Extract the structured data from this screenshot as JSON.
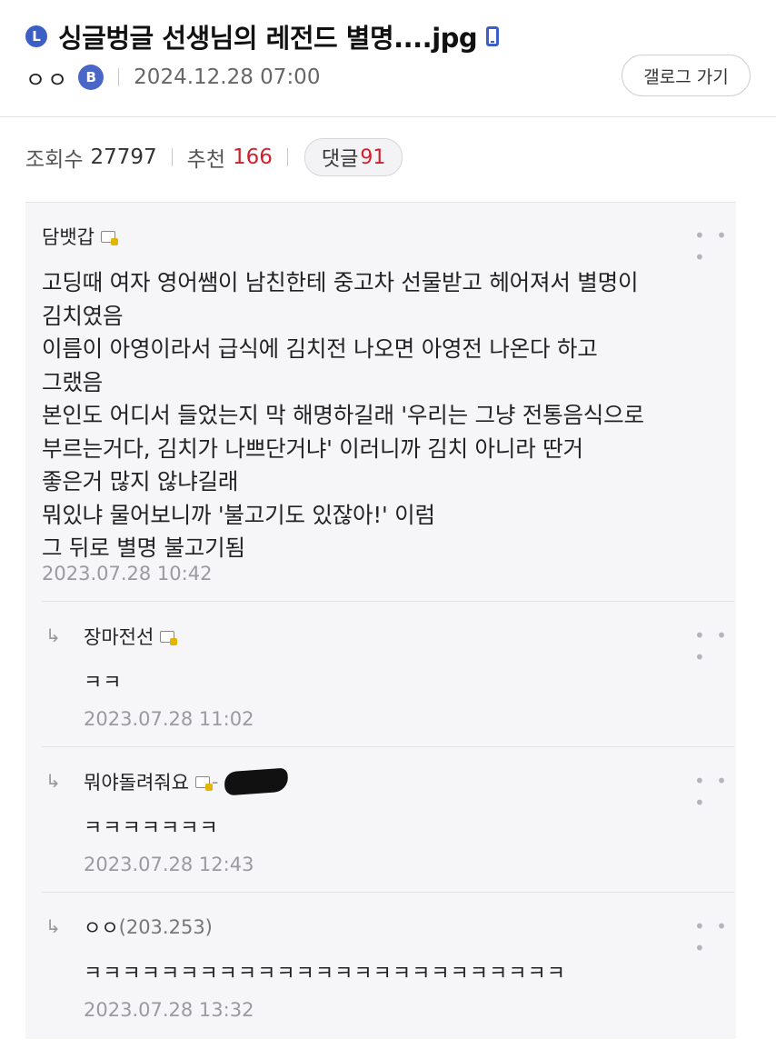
{
  "post": {
    "badge": "L",
    "title": "싱글벙글 선생님의 레전드 별명....jpg",
    "author": "ㅇㅇ",
    "author_badge": "B",
    "date": "2024.12.28 07:00",
    "gallery_button": "갤로그 가기"
  },
  "stats": {
    "views_label": "조회수",
    "views": "27797",
    "recommend_label": "추천",
    "recommend": "166",
    "comments_label": "댓글",
    "comments": "91"
  },
  "comments": [
    {
      "nick": "담뱃갑",
      "text": "고딩때 여자 영어쌤이 남친한테 중고차 선물받고 헤어져서 별명이\n김치였음\n이름이 아영이라서 급식에 김치전 나오면 아영전 나온다 하고\n그랬음\n본인도 어디서 들었는지 막 해명하길래 '우리는 그냥 전통음식으로\n부르는거다, 김치가 나쁘단거냐' 이러니까 김치 아니라 딴거\n좋은거 많지 않냐길래\n뭐있냐 물어보니까 '불고기도 있잖아!' 이럼\n그 뒤로 별명 불고기됨",
      "date": "2023.07.28 10:42"
    }
  ],
  "replies": [
    {
      "arrow": "↳",
      "nick": "장마전선",
      "text": "ㅋㅋ",
      "date": "2023.07.28 11:02"
    },
    {
      "arrow": "↳",
      "nick": "뭐야돌려줘요",
      "text": "ㅋㅋㅋㅋㅋㅋㅋ",
      "date": "2023.07.28 12:43"
    },
    {
      "arrow": "↳",
      "nick": "ㅇㅇ",
      "ip": "(203.253)",
      "text": "ㅋㅋㅋㅋㅋㅋㅋㅋㅋㅋㅋㅋㅋㅋㅋㅋㅋㅋㅋㅋㅋㅋㅋㅋㅋ",
      "date": "2023.07.28 13:32"
    }
  ],
  "more_glyph": "• • •",
  "colors": {
    "accent": "#3b5fc4",
    "count_red": "#d0202e"
  },
  "icons": [
    "l-badge",
    "phone-icon",
    "b-badge",
    "level-icon",
    "more-icon",
    "reply-arrow-icon"
  ]
}
